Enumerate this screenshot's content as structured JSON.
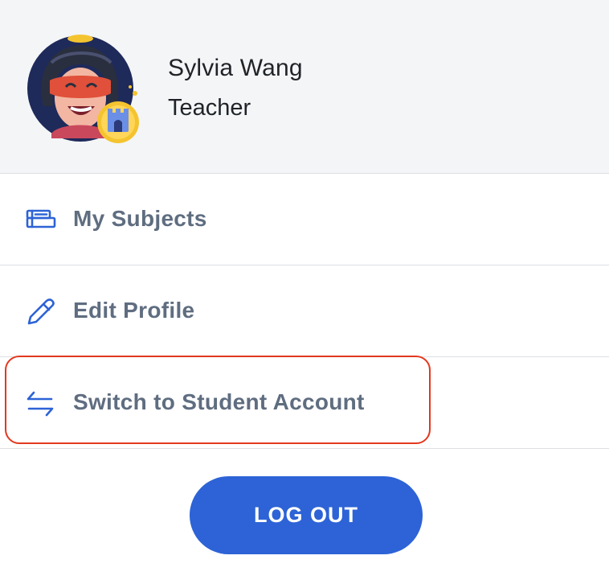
{
  "profile": {
    "name": "Sylvia Wang",
    "role": "Teacher"
  },
  "menu": {
    "items": [
      {
        "label": "My Subjects",
        "icon": "books-icon"
      },
      {
        "label": "Edit Profile",
        "icon": "pencil-icon"
      },
      {
        "label": "Switch to Student Account",
        "icon": "switch-arrows-icon"
      }
    ]
  },
  "actions": {
    "logout_label": "LOG OUT"
  },
  "colors": {
    "header_bg": "#f4f5f7",
    "menu_text": "#5f6d80",
    "icon_blue": "#2d63d6",
    "button_bg": "#2d63d6",
    "highlight": "#e3381f"
  }
}
